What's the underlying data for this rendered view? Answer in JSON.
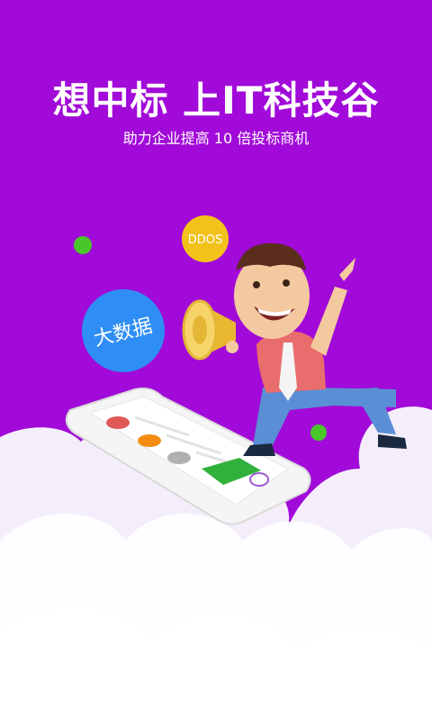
{
  "splash": {
    "title": "想中标  上IT科技谷",
    "subtitle": "助力企业提高 10 倍投标商机"
  },
  "bubbles": {
    "big_data": "大数据",
    "ddos": "DDOS"
  },
  "colors": {
    "background": "#a10ad8",
    "cloud": "#f4eefb",
    "bubble_blue": "#2f8ef5",
    "bubble_yellow": "#f3c21a",
    "dot_green": "#49c72a"
  }
}
